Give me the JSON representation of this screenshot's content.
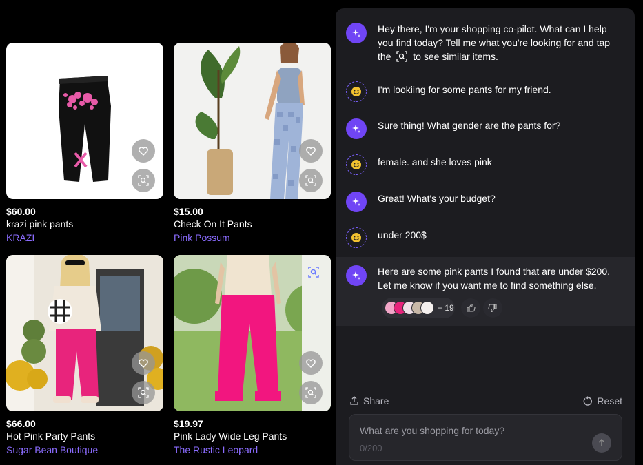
{
  "products": [
    {
      "price": "$60.00",
      "name": "krazi pink pants",
      "brand": "KRAZI"
    },
    {
      "price": "$15.00",
      "name": "Check On It Pants",
      "brand": "Pink Possum"
    },
    {
      "price": "$66.00",
      "name": "Hot Pink Party Pants",
      "brand": "Sugar Bean Boutique"
    },
    {
      "price": "$19.97",
      "name": "Pink Lady Wide Leg Pants",
      "brand": "The Rustic Leopard"
    }
  ],
  "chat": {
    "messages": [
      {
        "role": "bot",
        "text_before": "Hey there, I'm your shopping co-pilot. What can I help you find today? Tell me what you're looking for and tap the",
        "text_after": "to see similar items."
      },
      {
        "role": "user",
        "text": "I'm lookiing for some pants for my friend."
      },
      {
        "role": "bot",
        "text": "Sure thing! What gender are the pants for?"
      },
      {
        "role": "user",
        "text": "female. and she loves pink"
      },
      {
        "role": "bot",
        "text": "Great! What's your budget?"
      },
      {
        "role": "user",
        "text": "under 200$"
      },
      {
        "role": "bot",
        "text": "Here are some pink pants I found that are under $200. Let me know if you want me to find something else."
      }
    ],
    "results_more": "+ 19",
    "share_label": "Share",
    "reset_label": "Reset",
    "input_placeholder": "What are you shopping for today?",
    "char_counter": "0/200"
  },
  "colors": {
    "accent": "#7045f5",
    "brand_link": "#8b6cff",
    "panel_bg": "#1c1c20",
    "page_bg": "#000000"
  },
  "icons": [
    "heart-icon",
    "visual-search-icon",
    "sparkle-icon",
    "user-smiley-icon",
    "thumbs-up-icon",
    "thumbs-down-icon",
    "share-icon",
    "reset-icon",
    "send-arrow-icon"
  ]
}
